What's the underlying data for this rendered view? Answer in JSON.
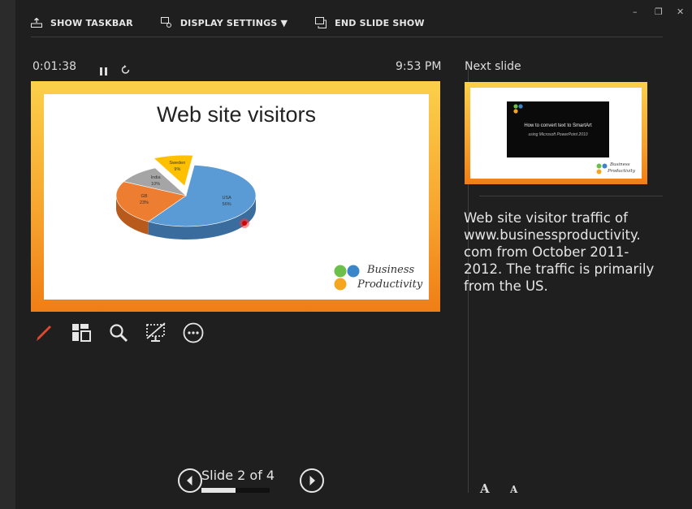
{
  "toolbar": {
    "show_taskbar": "SHOW TASKBAR",
    "display_settings": "DISPLAY SETTINGS ▼",
    "end_slide_show": "END SLIDE SHOW"
  },
  "window_controls": {
    "minimize": "–",
    "restore": "❐",
    "close": "✕"
  },
  "timer": "0:01:38",
  "clock": "9:53 PM",
  "next_slide_label": "Next slide",
  "current_slide": {
    "title": "Web site visitors",
    "logo_line1": "Business",
    "logo_line2": "Productivity"
  },
  "chart_data": {
    "type": "pie",
    "categories": [
      "USA",
      "GB",
      "India",
      "Sweden"
    ],
    "values": [
      56,
      23,
      10,
      9
    ],
    "labels": [
      "USA\n56%",
      "GB\n23%",
      "India\n10%",
      "Sweden\n9%"
    ]
  },
  "next_slide": {
    "line1": "How to convert text to SmartArt",
    "line2": "using Microsoft PowerPoint 2010",
    "logo_line1": "Business",
    "logo_line2": "Productivity"
  },
  "notes": "Web site visitor traffic of www.businessproductivity. com from October 2011-2012. The traffic is primarily from the US.",
  "slide_counter": "Slide 2 of 4",
  "progress": 0.5,
  "font_increase": "A",
  "font_decrease": "A",
  "colors": {
    "accent_pen": "#e0492f",
    "usa": "#5b9bd5",
    "gb": "#ed7d31",
    "india": "#a5a5a5",
    "sweden": "#ffc000"
  }
}
